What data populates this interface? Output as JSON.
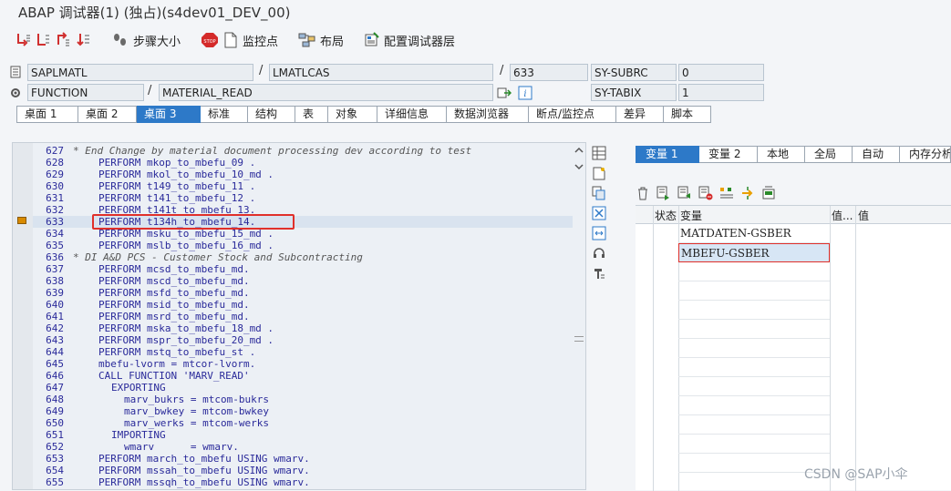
{
  "window": {
    "title": "ABAP 调试器(1)  (独占)(s4dev01_DEV_00)"
  },
  "toolbar": {
    "step_size": "步骤大小",
    "watchpoints": "监控点",
    "layout": "布局",
    "configure": "配置调试器层"
  },
  "header": {
    "program": "SAPLMATL",
    "include": "LMATLCAS",
    "line": "633",
    "subrc_label": "SY-SUBRC",
    "subrc_value": "0",
    "event_type": "FUNCTION",
    "event": "MATERIAL_READ",
    "tabix_label": "SY-TABIX",
    "tabix_value": "1",
    "slash": "/"
  },
  "tabs": [
    {
      "label": "桌面 1"
    },
    {
      "label": "桌面 2"
    },
    {
      "label": "桌面 3"
    },
    {
      "label": "标准"
    },
    {
      "label": "结构"
    },
    {
      "label": "表"
    },
    {
      "label": "对象"
    },
    {
      "label": "详细信息"
    },
    {
      "label": "数据浏览器"
    },
    {
      "label": "断点/监控点"
    },
    {
      "label": "差异"
    },
    {
      "label": "脚本"
    }
  ],
  "code": [
    {
      "no": "627",
      "text": "* End Change by material document processing dev according to test",
      "indent": 0
    },
    {
      "no": "628",
      "text": "PERFORM mkop_to_mbefu_09 .",
      "indent": 4
    },
    {
      "no": "629",
      "text": "PERFORM mkol_to_mbefu_10_md .",
      "indent": 4
    },
    {
      "no": "630",
      "text": "PERFORM t149_to_mbefu_11 .",
      "indent": 4
    },
    {
      "no": "631",
      "text": "PERFORM t141_to_mbefu_12 .",
      "indent": 4
    },
    {
      "no": "632",
      "text": "PERFORM t141t_to_mbefu_13.",
      "indent": 4
    },
    {
      "no": "633",
      "text": "PERFORM t134h_to_mbefu_14.",
      "indent": 4
    },
    {
      "no": "634",
      "text": "PERFORM msku_to_mbefu_15_md .",
      "indent": 4
    },
    {
      "no": "635",
      "text": "PERFORM mslb_to_mbefu_16_md .",
      "indent": 4
    },
    {
      "no": "636",
      "text": "* DI A&D PCS - Customer Stock and Subcontracting",
      "indent": 0
    },
    {
      "no": "637",
      "text": "PERFORM mcsd_to_mbefu_md.",
      "indent": 4
    },
    {
      "no": "638",
      "text": "PERFORM mscd_to_mbefu_md.",
      "indent": 4
    },
    {
      "no": "639",
      "text": "PERFORM msfd_to_mbefu_md.",
      "indent": 4
    },
    {
      "no": "640",
      "text": "PERFORM msid_to_mbefu_md.",
      "indent": 4
    },
    {
      "no": "641",
      "text": "PERFORM msrd_to_mbefu_md.",
      "indent": 4
    },
    {
      "no": "642",
      "text": "PERFORM mska_to_mbefu_18_md .",
      "indent": 4
    },
    {
      "no": "643",
      "text": "PERFORM mspr_to_mbefu_20_md .",
      "indent": 4
    },
    {
      "no": "644",
      "text": "PERFORM mstq_to_mbefu_st .",
      "indent": 4
    },
    {
      "no": "645",
      "text": "mbefu-lvorm = mtcor-lvorm.",
      "indent": 4
    },
    {
      "no": "646",
      "text": "CALL FUNCTION 'MARV_READ'",
      "indent": 4
    },
    {
      "no": "647",
      "text": "EXPORTING",
      "indent": 6
    },
    {
      "no": "648",
      "text": "marv_bukrs = mtcom-bukrs",
      "indent": 8
    },
    {
      "no": "649",
      "text": "marv_bwkey = mtcom-bwkey",
      "indent": 8
    },
    {
      "no": "650",
      "text": "marv_werks = mtcom-werks",
      "indent": 8
    },
    {
      "no": "651",
      "text": "IMPORTING",
      "indent": 6
    },
    {
      "no": "652",
      "text": "wmarv      = wmarv.",
      "indent": 8
    },
    {
      "no": "653",
      "text": "PERFORM march_to_mbefu USING wmarv.",
      "indent": 4
    },
    {
      "no": "654",
      "text": "PERFORM mssah_to_mbefu USING wmarv.",
      "indent": 4
    },
    {
      "no": "655",
      "text": "PERFORM mssqh_to_mbefu USING wmarv.",
      "indent": 4
    }
  ],
  "current_line": "633",
  "right_tabs": [
    {
      "label": "变量 1"
    },
    {
      "label": "变量 2"
    },
    {
      "label": "本地"
    },
    {
      "label": "全局"
    },
    {
      "label": "自动"
    },
    {
      "label": "内存分析"
    }
  ],
  "grid": {
    "col_status": "状态",
    "col_variable": "变量",
    "col_val_short": "值...",
    "col_value": "值",
    "rows": [
      {
        "variable": "MATDATEN-GSBER"
      },
      {
        "variable": "MBEFU-GSBER"
      }
    ]
  },
  "watermark": "CSDN @SAP小伞",
  "colors": {
    "accent": "#2d79c8",
    "highlight_box": "#e0302a"
  }
}
